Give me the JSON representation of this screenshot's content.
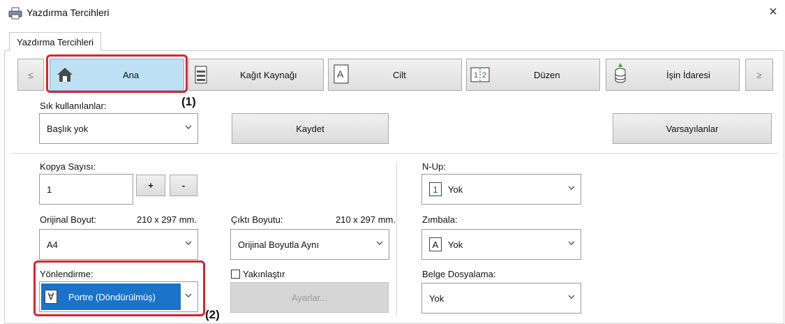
{
  "window": {
    "title": "Yazdırma Tercihleri",
    "close": "×"
  },
  "tab": {
    "label": "Yazdırma Tercihleri"
  },
  "nav": {
    "prev": "≤",
    "next": "≥",
    "items": [
      {
        "label": "Ana",
        "icon": "home-icon"
      },
      {
        "label": "Kağıt Kaynağı",
        "icon": "paper-tray-icon"
      },
      {
        "label": "Cilt",
        "icon": "binding-icon"
      },
      {
        "label": "Düzen",
        "icon": "layout-icon"
      },
      {
        "label": "İşin İdaresi",
        "icon": "job-handling-icon"
      }
    ]
  },
  "favorites": {
    "label": "Sık kullanılanlar:",
    "value": "Başlık yok",
    "save": "Kaydet",
    "defaults": "Varsayılanlar"
  },
  "copies": {
    "label": "Kopya Sayısı:",
    "value": "1",
    "plus": "+",
    "minus": "-"
  },
  "original_size": {
    "label": "Orijinal Boyut:",
    "dims": "210 x 297 mm.",
    "value": "A4"
  },
  "output_size": {
    "label": "Çıktı Boyutu:",
    "dims": "210 x 297 mm.",
    "value": "Orijinal Boyutla Aynı"
  },
  "orientation": {
    "label": "Yönlendirme:",
    "value": "Portre (Döndürülmüş)",
    "icon_glyph": "∀"
  },
  "zoom": {
    "label": "Yakınlaştır",
    "checked": false,
    "settings": "Ayarlar..."
  },
  "nup": {
    "label": "N-Up:",
    "value": "Yok",
    "icon_glyph": "1"
  },
  "staple": {
    "label": "Zımbala:",
    "value": "Yok",
    "icon_glyph": "A"
  },
  "retention": {
    "label": "Belge Dosyalama:",
    "value": "Yok"
  },
  "callouts": {
    "one": "(1)",
    "two": "(2)"
  },
  "colors": {
    "highlight": "#e0232b",
    "selected_combo": "#1a73c9",
    "active_tab": "#bde0f5"
  }
}
